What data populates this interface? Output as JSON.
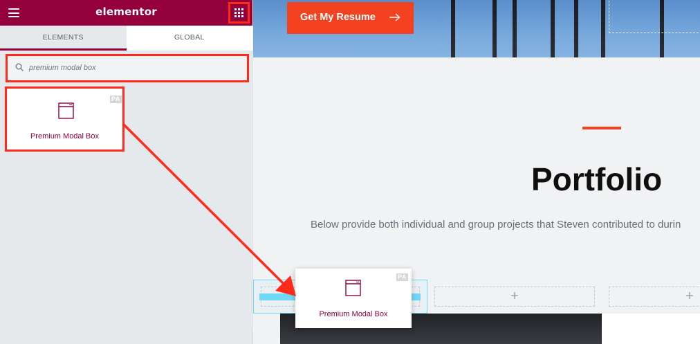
{
  "app": {
    "logo_text": "elementor"
  },
  "panel": {
    "tabs": [
      {
        "label": "ELEMENTS",
        "active": true
      },
      {
        "label": "GLOBAL",
        "active": false
      }
    ],
    "search": {
      "value": "premium modal box"
    },
    "widget": {
      "label": "Premium Modal Box",
      "badge": "PA",
      "icon": "window-icon"
    }
  },
  "preview": {
    "cta_label": "Get My Resume",
    "cta_icon": "arrow-right-icon",
    "section_title": "Portfolio",
    "section_description": "Below provide both individual and group projects that Steven contributed to durin"
  },
  "drag": {
    "label": "Premium Modal Box",
    "badge": "PA"
  },
  "colors": {
    "brand": "#93003c",
    "accent": "#f4411f",
    "highlight": "#ff2a1a",
    "drop_indicator": "#71d7f7"
  }
}
